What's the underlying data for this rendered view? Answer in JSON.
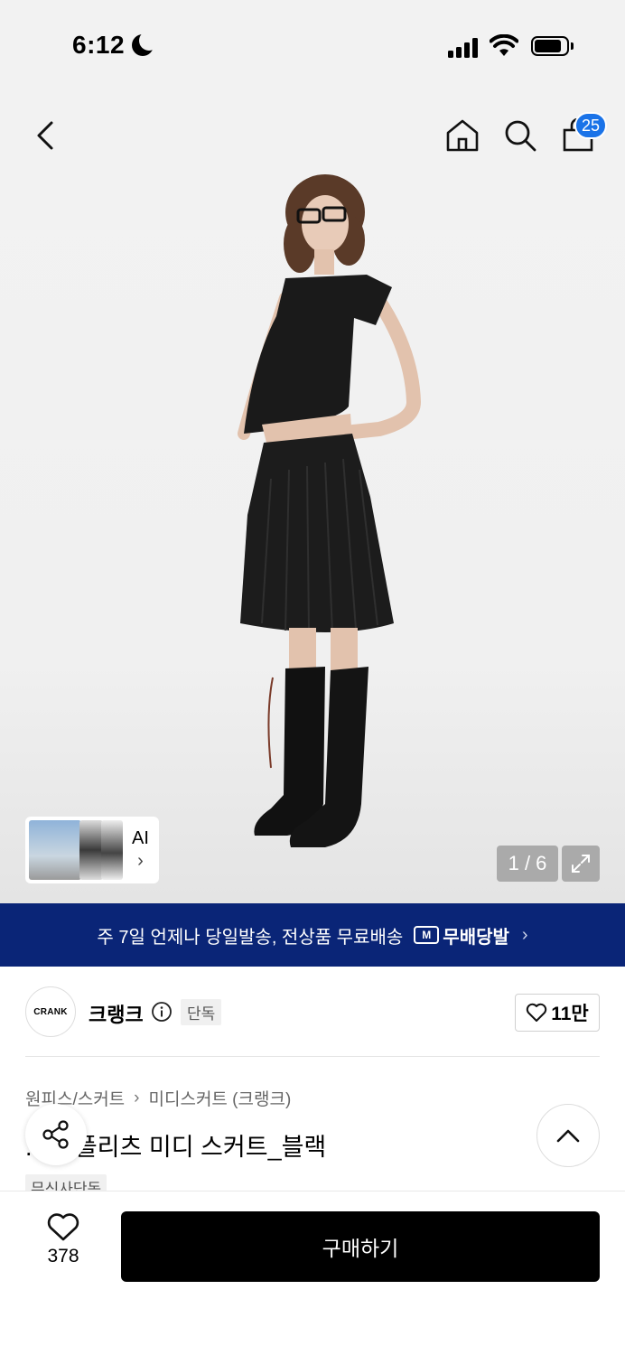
{
  "status_bar": {
    "time": "6:12"
  },
  "header": {
    "back_icon": "chevron-left-icon",
    "home_icon": "home-icon",
    "search_icon": "search-icon",
    "bag_icon": "shopping-bag-icon",
    "cart_count": "25",
    "badge_color": "#1a73e8"
  },
  "gallery": {
    "ai_label": "AI",
    "pager": "1 / 6",
    "expand_icon": "expand-icon"
  },
  "banner": {
    "text": "주 7일 언제나 당일발송, 전상품 무료배송",
    "logo_text": "무배당발",
    "logo_icon_text": "M",
    "background": "#0a2577"
  },
  "brand": {
    "logo_text": "CRANK",
    "name": "크랭크",
    "tag": "단독",
    "likes": "11만"
  },
  "product": {
    "breadcrumb": [
      "원피스/스커트",
      "미디스커트 (크랭크)"
    ],
    "title": "...트 플리츠 미디 스커트_블랙",
    "tag": "무신사단독"
  },
  "bottom_bar": {
    "wish_count": "378",
    "buy_label": "구매하기"
  }
}
